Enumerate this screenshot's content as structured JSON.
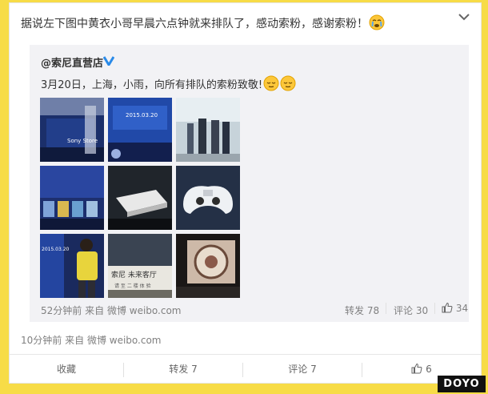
{
  "post": {
    "text": "据说左下图中黄衣小哥早晨六点钟就来排队了，感动索粉，感谢索粉！",
    "emoji_icon": "crying-face-icon",
    "time": "10分钟前",
    "source_prefix": "来自",
    "source": "微博 weibo.com"
  },
  "repost": {
    "author": "@索尼直营店",
    "verified_icon": "verified-v-icon",
    "text": "3月20日，上海，小雨，向所有排队的索粉致敬!",
    "emoji_icon": "relieved-face-icon",
    "time": "52分钟前",
    "source_prefix": "来自",
    "source": "微博 weibo.com",
    "stats": {
      "forward_label": "转发",
      "forward_count": "78",
      "comment_label": "评论",
      "comment_count": "30",
      "like_count": "34"
    },
    "images": [
      {
        "name": "sony-store-photo",
        "caption": "Sony Store"
      },
      {
        "name": "playstation-banner-photo",
        "caption": "2015.03.20"
      },
      {
        "name": "queue-people-photo",
        "caption": ""
      },
      {
        "name": "game-shelf-photo",
        "caption": ""
      },
      {
        "name": "ps4-console-photo",
        "caption": ""
      },
      {
        "name": "ps4-controller-photo",
        "caption": ""
      },
      {
        "name": "yellow-jacket-fan-photo",
        "caption": "2015.03.20"
      },
      {
        "name": "sony-sign-photo",
        "caption": "索尼 未来客厅"
      },
      {
        "name": "display-screen-photo",
        "caption": ""
      }
    ],
    "sign_sub": "请 至 二 楼 体 验"
  },
  "actions": {
    "favorite": "收藏",
    "forward": "转发 7",
    "comment": "评论 7",
    "like": "6"
  },
  "watermark": "DOYO",
  "colors": {
    "background": "#f7dc47",
    "link": "#eb7350"
  }
}
